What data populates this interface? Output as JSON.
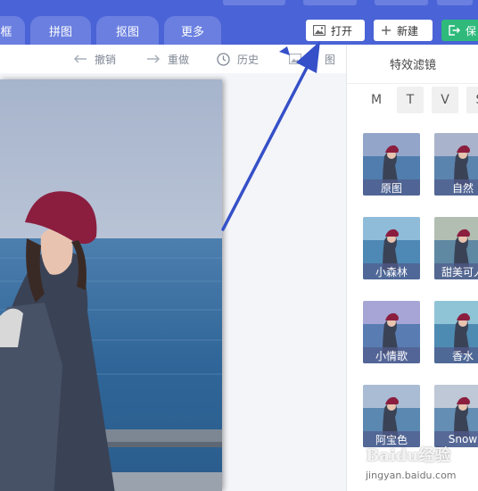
{
  "nav": {
    "tabs": [
      {
        "label": "框"
      },
      {
        "label": "拼图"
      },
      {
        "label": "抠图"
      },
      {
        "label": "更多"
      }
    ],
    "open_label": "打开",
    "new_label": "新建",
    "save_label": "保"
  },
  "toolbar": {
    "undo_label": "撤销",
    "redo_label": "重做",
    "history_label": "历史",
    "image_label": "图"
  },
  "panel": {
    "title": "特效滤镜",
    "letters": [
      "M",
      "T",
      "V",
      "S"
    ],
    "filters": [
      {
        "label": "原图",
        "tint": "#6f88b8"
      },
      {
        "label": "自然",
        "tint": "#8c9aba"
      },
      {
        "label": "小森林",
        "tint": "#6aa6cc"
      },
      {
        "label": "甜美可人",
        "tint": "#9aa89a"
      },
      {
        "label": "小情歌",
        "tint": "#8a86c8"
      },
      {
        "label": "香水",
        "tint": "#6ab0c8"
      },
      {
        "label": "阿宝色",
        "tint": "#8ea6c4"
      },
      {
        "label": "Snow",
        "tint": "#a8b6c8"
      }
    ]
  },
  "watermark": {
    "brand": "Baidu经验",
    "url": "jingyan.baidu.com"
  },
  "colors": {
    "nav_bg": "#4a63d6",
    "tab_bg": "#6a7fe0",
    "accent_green": "#2fba7c",
    "arrow": "#3550c8"
  }
}
